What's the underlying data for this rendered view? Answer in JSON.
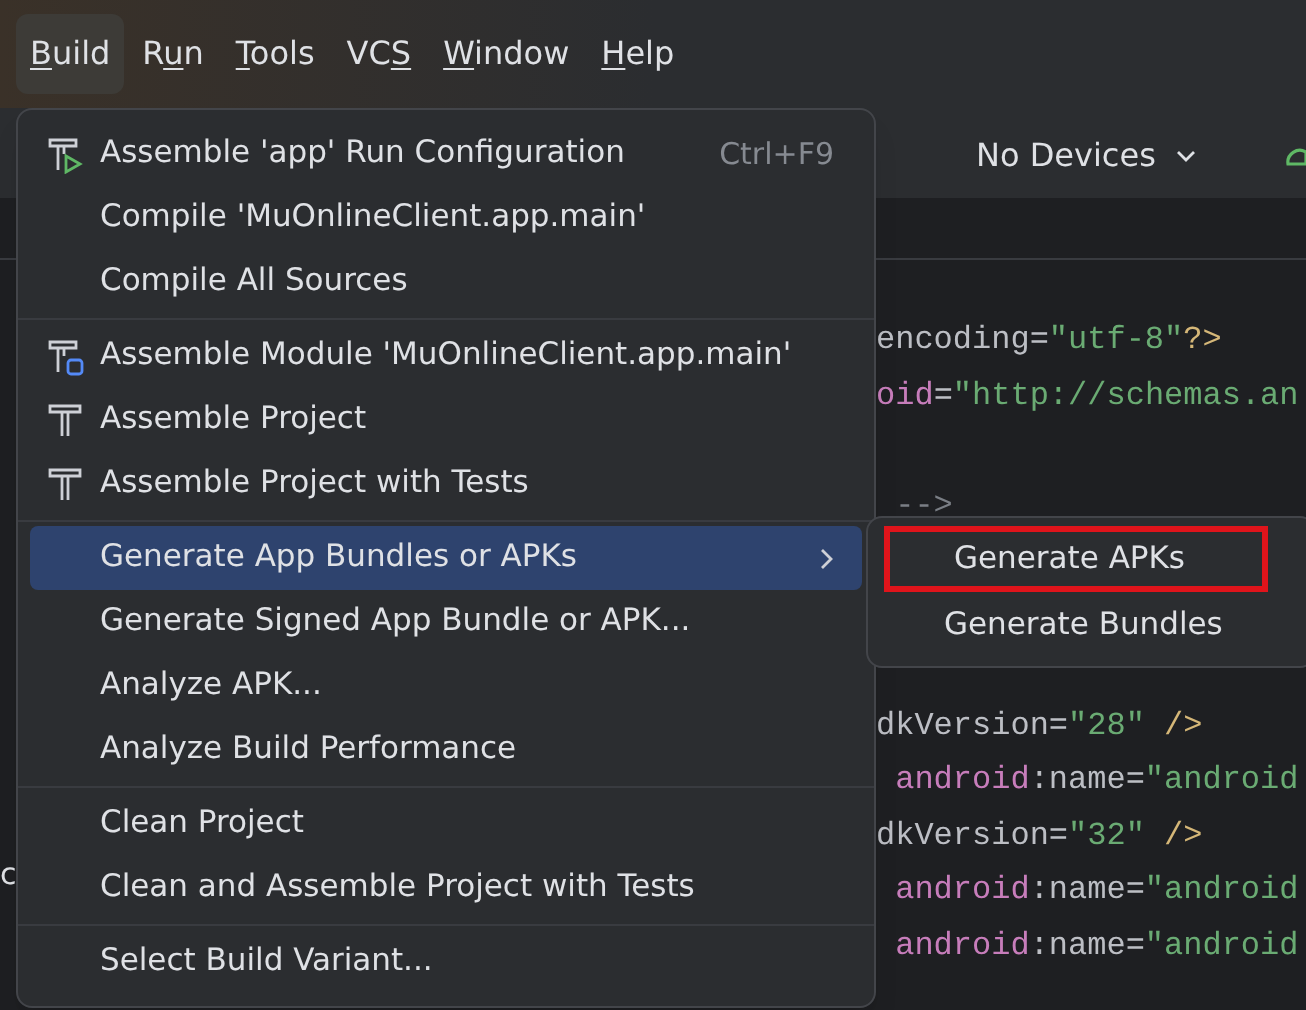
{
  "menu_bar": [
    {
      "key": "B",
      "post": "uild",
      "selected": true
    },
    {
      "pre": "R",
      "key": "u",
      "post": "n",
      "selected": false
    },
    {
      "key": "T",
      "post": "ools",
      "selected": false
    },
    {
      "pre": "VC",
      "key": "S",
      "selected": false
    },
    {
      "key": "W",
      "post": "indow",
      "selected": false
    },
    {
      "key": "H",
      "post": "elp",
      "selected": false
    }
  ],
  "toolbar": {
    "device_selector": "No Devices"
  },
  "side_fragments": [
    "c"
  ],
  "code_lines": [
    [
      {
        "text": "encoding=",
        "kind": "plain"
      },
      {
        "text": "\"utf-8\"",
        "kind": "string"
      },
      {
        "text": "?>",
        "kind": "punct"
      }
    ],
    [
      {
        "text": "oid",
        "kind": "attr"
      },
      {
        "text": "=",
        "kind": "plain"
      },
      {
        "text": "\"http://schemas.an",
        "kind": "string"
      }
    ],
    [
      {
        "text": " -->",
        "kind": "comment"
      }
    ],
    [
      {
        "text": "dkVersion=",
        "kind": "plain"
      },
      {
        "text": "\"28\"",
        "kind": "string"
      },
      {
        "text": " />",
        "kind": "punct"
      }
    ],
    [
      {
        "text": " android",
        "kind": "attr"
      },
      {
        "text": ":name=",
        "kind": "plain"
      },
      {
        "text": "\"android",
        "kind": "string"
      }
    ],
    [
      {
        "text": "dkVersion=",
        "kind": "plain"
      },
      {
        "text": "\"32\"",
        "kind": "string"
      },
      {
        "text": " />",
        "kind": "punct"
      }
    ],
    [
      {
        "text": " android",
        "kind": "attr"
      },
      {
        "text": ":name=",
        "kind": "plain"
      },
      {
        "text": "\"android",
        "kind": "string"
      }
    ],
    [
      {
        "text": " android",
        "kind": "attr"
      },
      {
        "text": ":name=",
        "kind": "plain"
      },
      {
        "text": "\"android",
        "kind": "string"
      }
    ]
  ],
  "build_menu": {
    "groups": [
      [
        {
          "label": "Assemble 'app' Run Configuration",
          "kind": "hammer-run",
          "shortcut": "Ctrl+F9",
          "selected": false
        },
        {
          "label": "Compile 'MuOnlineClient.app.main'",
          "selected": false
        },
        {
          "label": "Compile All Sources",
          "selected": false
        }
      ],
      [
        {
          "label": "Assemble Module 'MuOnlineClient.app.main'",
          "kind": "hammer-module",
          "selected": false
        },
        {
          "label": "Assemble Project",
          "kind": "hammer",
          "selected": false
        },
        {
          "label": "Assemble Project with Tests",
          "kind": "hammer",
          "selected": false
        }
      ],
      [
        {
          "label": "Generate App Bundles or APKs",
          "submenu": true,
          "selected": true
        },
        {
          "label": "Generate Signed App Bundle or APK...",
          "selected": false
        },
        {
          "label": "Analyze APK...",
          "selected": false
        },
        {
          "label": "Analyze Build Performance",
          "selected": false
        }
      ],
      [
        {
          "label": "Clean Project",
          "selected": false
        },
        {
          "label": "Clean and Assemble Project with Tests",
          "selected": false
        }
      ],
      [
        {
          "label": "Select Build Variant...",
          "selected": false
        }
      ]
    ]
  },
  "submenu": [
    {
      "label": "Generate APKs",
      "highlighted": true
    },
    {
      "label": "Generate Bundles",
      "highlighted": false
    }
  ]
}
